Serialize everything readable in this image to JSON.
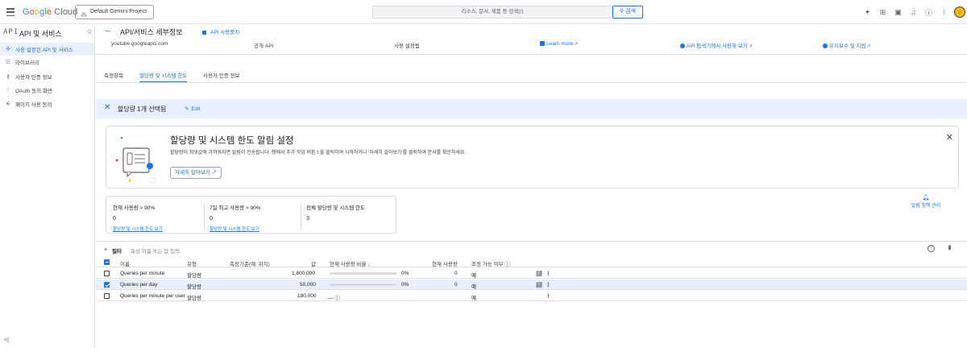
{
  "topbar": {
    "brand": [
      "G",
      "o",
      "o",
      "g",
      "l",
      "e"
    ],
    "brand_suffix": " Cloud",
    "project": "Default Gemini Project",
    "search_placeholder": "리소스, 문서, 제품 등 검색(/)",
    "search_button": "검색",
    "icons": [
      "gemini-sparkle-icon",
      "gift-icon",
      "terminal-icon",
      "bell-icon",
      "help-icon",
      "more-vert-icon",
      "avatar"
    ]
  },
  "sidebar": {
    "logo": "API",
    "title": "API 및 서비스",
    "items": [
      {
        "label": "사용 설정된 API 및 서비스",
        "icon": "✢",
        "active": true
      },
      {
        "label": "라이브러리",
        "icon": "☷",
        "active": false
      },
      {
        "label": "사용자 인증 정보",
        "icon": "⚷",
        "active": false
      },
      {
        "label": "OAuth 동의 화면",
        "icon": "⁝",
        "active": false
      },
      {
        "label": "페이지 사용 동의",
        "icon": "⚟",
        "active": false
      }
    ],
    "collapse": "<|"
  },
  "header": {
    "title": "API/서비스 세부정보",
    "stop_label": "API 사용중지"
  },
  "info": {
    "service_name": "youtube.googleapis.com",
    "type": "공개 API",
    "status": "사용 설정됨",
    "learn_more": "Learn more",
    "try_api": "API 탐색기에서 사용해 보기",
    "support": "유지보수 및 지원"
  },
  "tabs": [
    {
      "label": "측정항목",
      "active": false
    },
    {
      "label": "할당량 및 시스템 한도",
      "active": true
    },
    {
      "label": "사용자 인증 정보",
      "active": false
    }
  ],
  "selection": {
    "text": "할당량 1개 선택됨",
    "edit": "Edit"
  },
  "notice": {
    "title": "할당량 및 시스템 한도 알림 설정",
    "description_before": "할당량이 최댓값에 가까워지면 알림이 전송됩니다. 행에서 추가 작업 버튼",
    "description_after": "을 클릭하여 시작하거나 '자세히 알아보기'를 클릭하여 문서를 확인하세요.",
    "button": "자세히 알아보기"
  },
  "stats": [
    {
      "label": "현재 사용량 > 90%",
      "value": "0",
      "link": "할당량 및 시스템 한도 보기"
    },
    {
      "label": "7일 최고 사용량 > 90%",
      "value": "0",
      "link": "할당량 및 시스템 한도 보기"
    },
    {
      "label": "전체 할당량 및 시스템 한도",
      "value": "3",
      "link": ""
    }
  ],
  "alert_manage": "알림 정책 관리",
  "filter": {
    "label": "필터",
    "placeholder": "속성 이름 또는 값 입력"
  },
  "table": {
    "columns": [
      "이름",
      "유형",
      "측정기준(예: 위치)",
      "값",
      "현재 사용량 비율",
      "현재 사용량",
      "조정 가능 여부"
    ],
    "rows": [
      {
        "name": "Queries per minute",
        "type": "할당량",
        "dimension": "",
        "value": "1,800,000",
        "ratio_text": "0%",
        "ratio": 0.0,
        "usage": "0",
        "adjustable": "예",
        "checked": false,
        "chart": true
      },
      {
        "name": "Queries per day",
        "type": "할당량",
        "dimension": "",
        "value": "50,000",
        "ratio_text": "0%",
        "ratio": 0.0,
        "usage": "0",
        "adjustable": "예",
        "checked": true,
        "chart": true
      },
      {
        "name": "Queries per minute per user",
        "type": "할당량",
        "dimension": "",
        "value": "180,000",
        "ratio_text": "—",
        "ratio": null,
        "usage": "",
        "adjustable": "예",
        "checked": false,
        "chart": false
      }
    ]
  },
  "colors": {
    "accent": "#1a73e8",
    "selected_bg": "#e8f0fe",
    "border": "#dadce0"
  }
}
